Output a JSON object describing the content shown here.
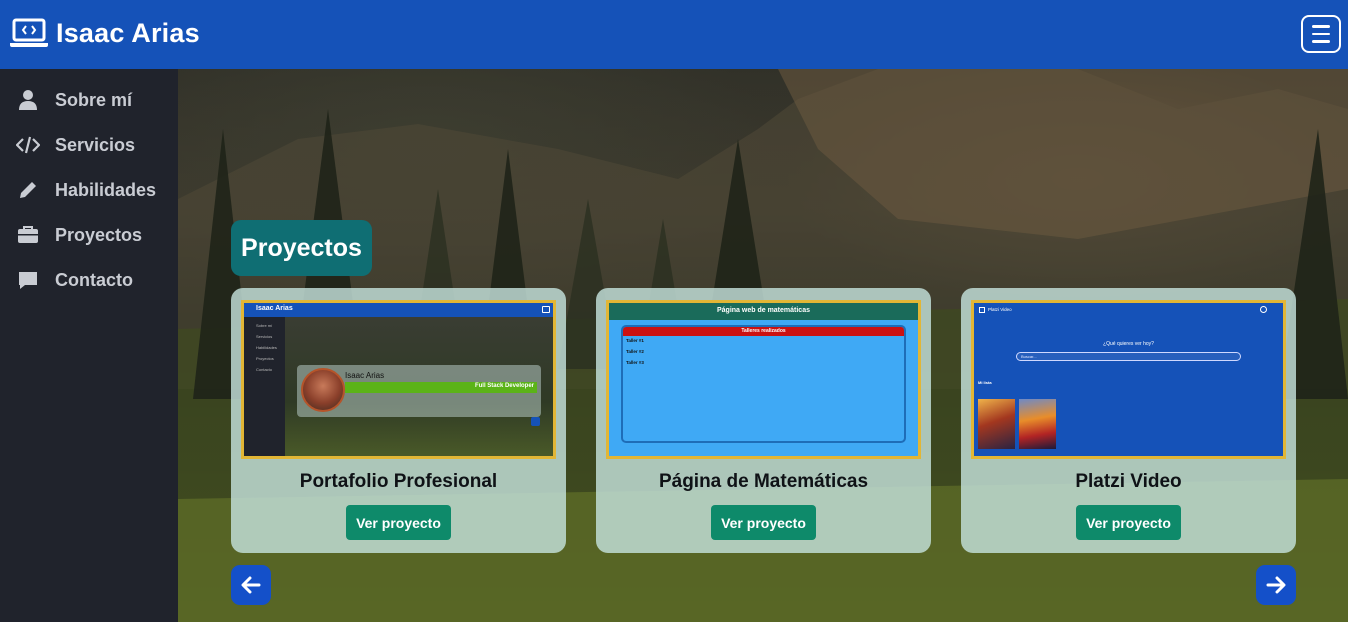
{
  "header": {
    "title": "Isaac Arias",
    "brand_icon": "laptop-code-icon",
    "menu_icon": "hamburger-menu-icon"
  },
  "colors": {
    "header": "#1552b8",
    "sidebar": "#20232c",
    "section_title": "#0f6e73",
    "button": "#0e8a6a",
    "thumb_border": "#e2b635",
    "arrow": "#1450c9"
  },
  "sidebar": {
    "items": [
      {
        "label": "Sobre mí",
        "icon": "user-icon"
      },
      {
        "label": "Servicios",
        "icon": "code-icon"
      },
      {
        "label": "Habilidades",
        "icon": "pencil-icon"
      },
      {
        "label": "Proyectos",
        "icon": "briefcase-icon"
      },
      {
        "label": "Contacto",
        "icon": "comment-icon"
      }
    ]
  },
  "main": {
    "section_title": "Proyectos",
    "cards": [
      {
        "title": "Portafolio Profesional",
        "button": "Ver proyecto",
        "thumb": {
          "header": "Isaac Arias",
          "menu": [
            "Sobre mí",
            "Servicios",
            "Habilidades",
            "Proyectos",
            "Contacto"
          ],
          "name": "Isaac Arias",
          "role": "Full Stack Developer"
        }
      },
      {
        "title": "Página de Matemáticas",
        "button": "Ver proyecto",
        "thumb": {
          "header": "Página web de matemáticas",
          "panel_title": "Talleres realizados",
          "items": [
            "Taller #1",
            "Taller #2",
            "Taller #3"
          ]
        }
      },
      {
        "title": "Platzi Video",
        "button": "Ver proyecto",
        "thumb": {
          "header": "Platzi Video",
          "question": "¿Qué quieres ver hoy?",
          "search_placeholder": "Buscar...",
          "section": "Mi lista"
        }
      }
    ],
    "prev_icon": "arrow-left-icon",
    "next_icon": "arrow-right-icon"
  }
}
